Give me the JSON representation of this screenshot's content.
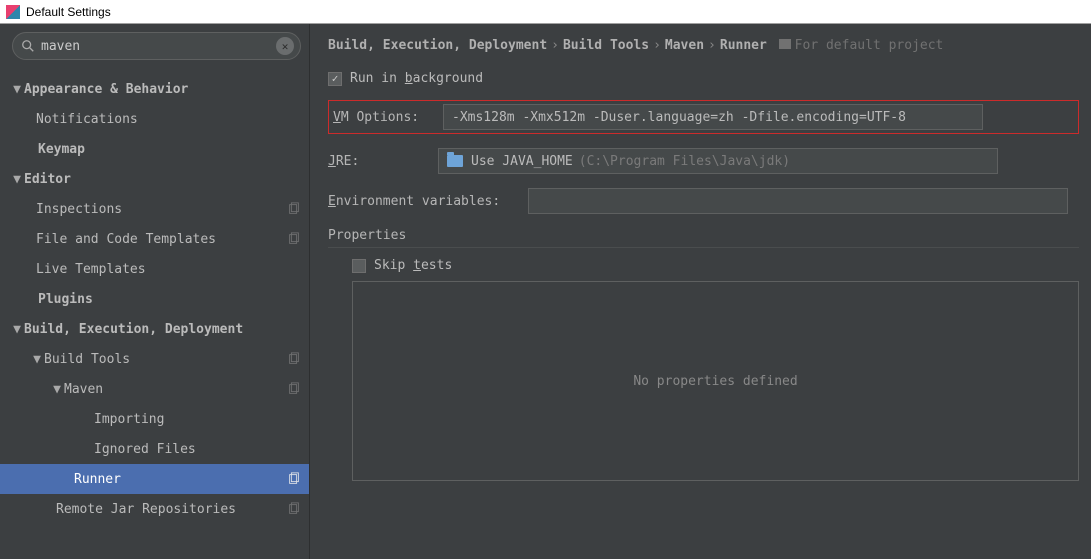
{
  "window": {
    "title": "Default Settings"
  },
  "search": {
    "value": "maven"
  },
  "tree": {
    "appearanceBehavior": "Appearance & Behavior",
    "notifications": "Notifications",
    "keymap": "Keymap",
    "editor": "Editor",
    "inspections": "Inspections",
    "fileCodeTemplates": "File and Code Templates",
    "liveTemplates": "Live Templates",
    "plugins": "Plugins",
    "buildExecDeploy": "Build, Execution, Deployment",
    "buildTools": "Build Tools",
    "maven": "Maven",
    "importing": "Importing",
    "ignoredFiles": "Ignored Files",
    "runner": "Runner",
    "remoteJar": "Remote Jar Repositories"
  },
  "breadcrumb": {
    "p1": "Build, Execution, Deployment",
    "p2": "Build Tools",
    "p3": "Maven",
    "p4": "Runner",
    "scope": "For default project"
  },
  "form": {
    "runBg_b": "b",
    "runBg_rest": "ackground",
    "runBg_pre": "Run in ",
    "vmLabel_V": "V",
    "vmLabel_rest": "M Options:",
    "vmValue": "-Xms128m -Xmx512m -Duser.language=zh -Dfile.encoding=UTF-8",
    "jreLabel_J": "J",
    "jreLabel_rest": "RE:",
    "jreValue": "Use JAVA_HOME",
    "jreHint": "(C:\\Program Files\\Java\\jdk)",
    "envLabel_E": "E",
    "envLabel_rest": "nvironment variables:",
    "envValue": "",
    "propsTitle": "Properties",
    "skip_t": "t",
    "skip_pre": "Skip ",
    "skip_post": "ests",
    "noProps": "No properties defined"
  }
}
